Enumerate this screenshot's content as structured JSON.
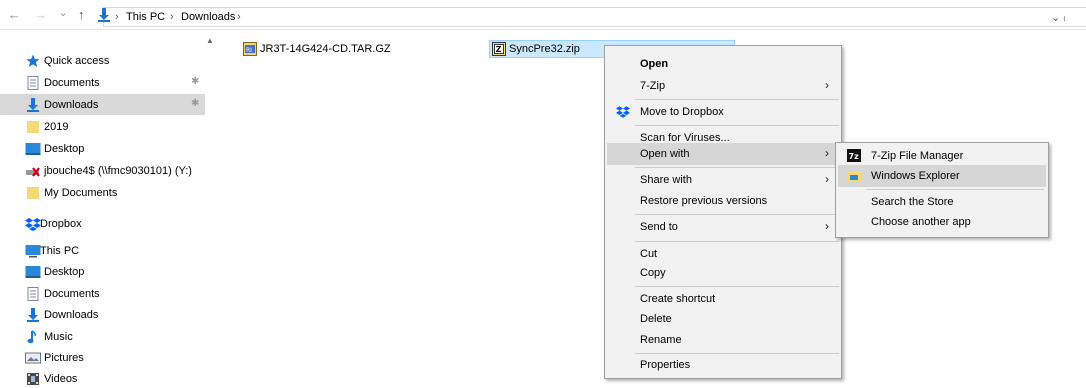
{
  "address": {
    "back_glyph": "←",
    "forward_glyph": "→",
    "recent_glyph": "⌄",
    "up_glyph": "↑",
    "path": [
      "This PC",
      "Downloads"
    ],
    "sep": "›",
    "dropdown": "⌄ ₍"
  },
  "nav": {
    "scroll_up_glyph": "▲",
    "items": [
      {
        "label": "Quick access",
        "icon": "star-icon",
        "pinned": false
      },
      {
        "label": "Documents",
        "icon": "documents-icon",
        "pinned": true
      },
      {
        "label": "Downloads",
        "icon": "download-arrow-icon",
        "pinned": true,
        "selected": true
      },
      {
        "label": "2019",
        "icon": "folder-icon",
        "pinned": false
      },
      {
        "label": "Desktop",
        "icon": "desktop-icon",
        "pinned": false
      },
      {
        "label": "jbouche4$ (\\\\fmc9030101) (Y:)",
        "icon": "disconnected-drive-icon",
        "pinned": false
      },
      {
        "label": "My Documents",
        "icon": "folder-icon",
        "pinned": false
      },
      {
        "label": "Dropbox",
        "icon": "dropbox-icon",
        "pinned": false
      },
      {
        "label": "This PC",
        "icon": "computer-icon",
        "pinned": false
      },
      {
        "label": "Desktop",
        "icon": "desktop-icon",
        "pinned": false
      },
      {
        "label": "Documents",
        "icon": "documents-icon",
        "pinned": false
      },
      {
        "label": "Downloads",
        "icon": "download-arrow-icon",
        "pinned": false
      },
      {
        "label": "Music",
        "icon": "music-icon",
        "pinned": false
      },
      {
        "label": "Pictures",
        "icon": "pictures-icon",
        "pinned": false
      },
      {
        "label": "Videos",
        "icon": "videos-icon",
        "pinned": false
      }
    ],
    "pin_glyph": "📌"
  },
  "files": [
    {
      "name": "JR3T-14G424-CD.TAR.GZ",
      "icon": "archive-icon"
    },
    {
      "name": "SyncPre32.zip",
      "icon": "zip-icon",
      "selected": true
    }
  ],
  "context_menu": {
    "items": [
      {
        "label": "Open",
        "bold": true
      },
      {
        "label": "7-Zip",
        "submenu": true
      },
      {
        "label": "Move to Dropbox",
        "icon": "dropbox-icon"
      },
      {
        "label": "Scan for Viruses..."
      },
      {
        "label": "Open with",
        "submenu": true,
        "hover": true
      },
      {
        "label": "Share with",
        "submenu": true
      },
      {
        "label": "Restore previous versions"
      },
      {
        "label": "Send to",
        "submenu": true
      },
      {
        "label": "Cut"
      },
      {
        "label": "Copy"
      },
      {
        "label": "Create shortcut"
      },
      {
        "label": "Delete"
      },
      {
        "label": "Rename"
      },
      {
        "label": "Properties"
      }
    ],
    "arrow_glyph": "›"
  },
  "open_with_menu": {
    "items": [
      {
        "label": "7-Zip File Manager",
        "icon": "7zip-icon"
      },
      {
        "label": "Windows Explorer",
        "icon": "folder-explorer-icon",
        "hover": true
      },
      {
        "label": "Search the Store"
      },
      {
        "label": "Choose another app"
      }
    ]
  },
  "colors": {
    "selection_bg": "#cce8ff",
    "nav_selected_bg": "#d9d9d9",
    "menu_bg": "#f2f2f2",
    "menu_hover_bg": "#d6d6d6",
    "accent_blue": "#1e73d6",
    "folder_yellow": "#f8d775"
  }
}
